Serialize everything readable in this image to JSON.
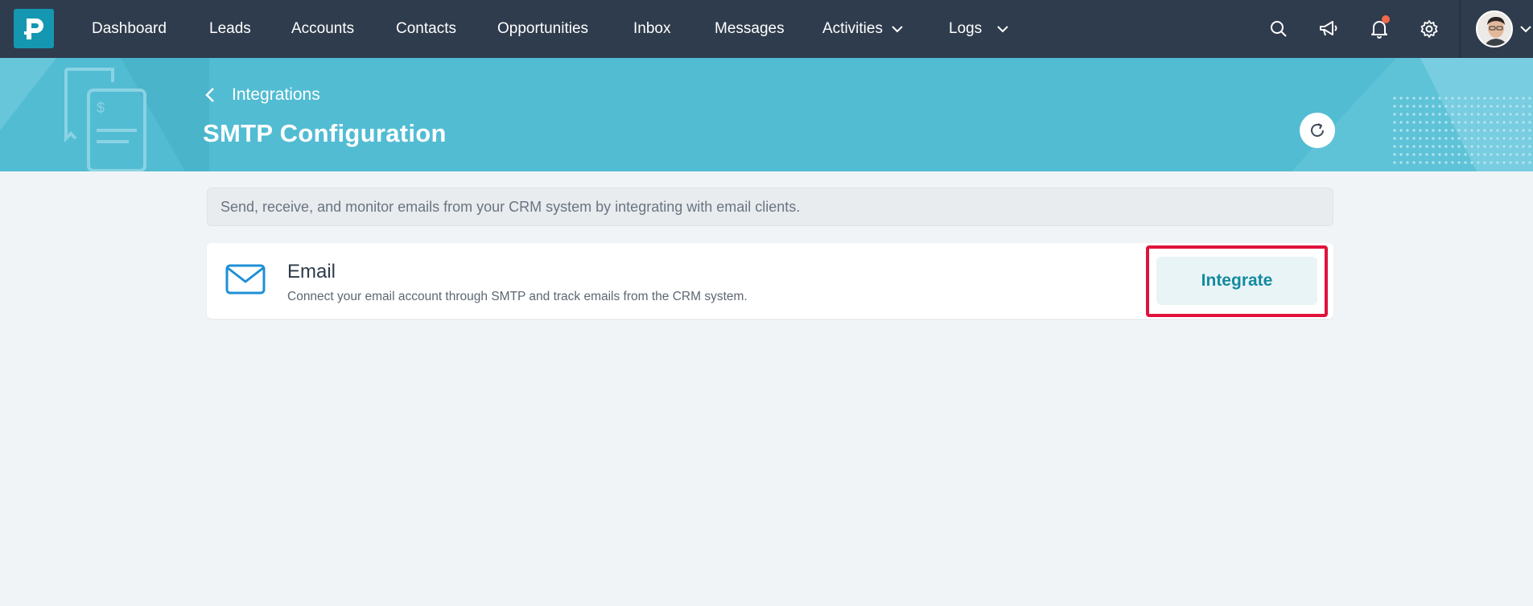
{
  "nav": {
    "logo_letter": "P",
    "items": [
      {
        "label": "Dashboard"
      },
      {
        "label": "Leads"
      },
      {
        "label": "Accounts"
      },
      {
        "label": "Contacts"
      },
      {
        "label": "Opportunities"
      },
      {
        "label": "Inbox"
      },
      {
        "label": "Messages"
      },
      {
        "label": "Activities",
        "dropdown": true
      },
      {
        "label": "Logs",
        "dropdown": true
      }
    ],
    "icons": [
      "search-icon",
      "megaphone-icon",
      "bell-icon",
      "gear-icon"
    ],
    "notification_dot_color": "#f26a4b"
  },
  "banner": {
    "back_label": "Integrations",
    "title": "SMTP Configuration",
    "background_color": "#52bcd3"
  },
  "info_text": "Send, receive, and monitor emails from your CRM system by integrating with email clients.",
  "email_card": {
    "title": "Email",
    "description": "Connect your email account through SMTP and track emails from the CRM system.",
    "button_label": "Integrate",
    "highlight_color": "#e0123c"
  }
}
